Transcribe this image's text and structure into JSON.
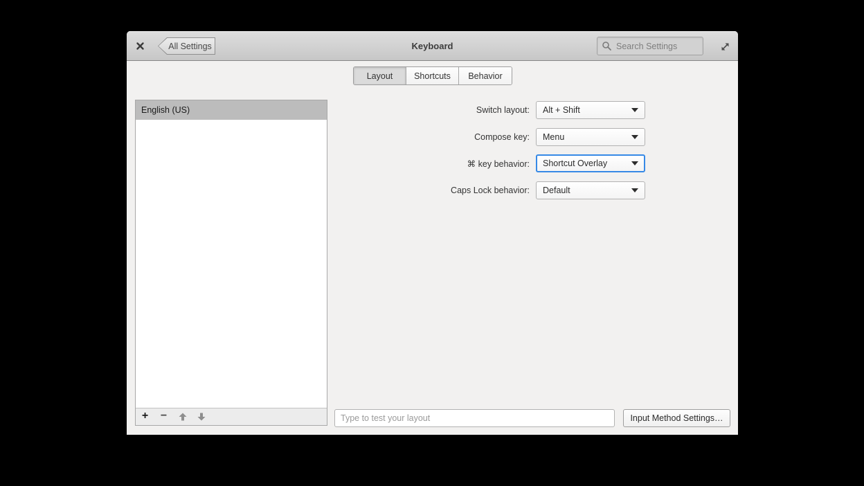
{
  "window": {
    "title": "Keyboard",
    "back_button_label": "All Settings",
    "search_placeholder": "Search Settings"
  },
  "tabs": [
    {
      "label": "Layout",
      "active": true
    },
    {
      "label": "Shortcuts",
      "active": false
    },
    {
      "label": "Behavior",
      "active": false
    }
  ],
  "layout_list": {
    "items": [
      "English (US)"
    ],
    "selected_index": 0,
    "toolbar": {
      "add_glyph": "+",
      "remove_glyph": "−"
    }
  },
  "settings_rows": [
    {
      "label": "Switch layout:",
      "value": "Alt + Shift",
      "focused": false
    },
    {
      "label": "Compose key:",
      "value": "Menu",
      "focused": false
    },
    {
      "label": "⌘ key behavior:",
      "value": "Shortcut Overlay",
      "focused": true
    },
    {
      "label": "Caps Lock behavior:",
      "value": "Default",
      "focused": false
    }
  ],
  "footer": {
    "test_input_placeholder": "Type to test your layout",
    "input_method_button_label": "Input Method Settings…"
  },
  "icons": {
    "close": "x-cross",
    "back": "chevron-left-shape",
    "search": "magnifier",
    "expand": "diagonal-resize-arrows",
    "dropdown_caret": "caret-down",
    "move_up": "arrow-up",
    "move_down": "arrow-down"
  },
  "colors": {
    "desktop_background": "#000000",
    "window_background": "#f2f1f0",
    "header_gradient_top": "#dedede",
    "header_gradient_bottom": "#c7c7c7",
    "selected_row_background": "#bcbcbc",
    "focus_border_blue": "#3689e6",
    "text_dark": "#333333",
    "placeholder_gray": "#9a9a9a"
  }
}
